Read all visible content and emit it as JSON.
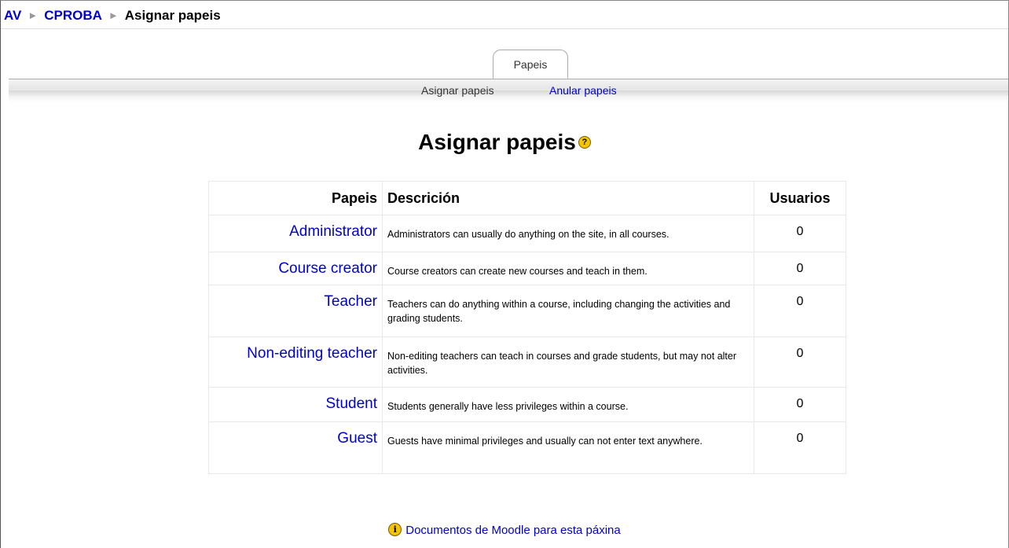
{
  "breadcrumb": {
    "items": [
      {
        "label": "AV"
      },
      {
        "label": "CPROBA"
      }
    ],
    "separator": "►",
    "current": "Asignar papeis"
  },
  "tabs": {
    "main": "Papeis",
    "sub": {
      "selected": "Asignar papeis",
      "other": "Anular papeis"
    }
  },
  "page": {
    "heading": "Asignar papeis",
    "help_icon_glyph": "?"
  },
  "table": {
    "headers": {
      "role": "Papeis",
      "description": "Descrición",
      "users": "Usuarios"
    },
    "rows": [
      {
        "role": "Administrator",
        "description": "Administrators can usually do anything on the site, in all courses.",
        "users": "0"
      },
      {
        "role": "Course creator",
        "description": "Course creators can create new courses and teach in them.",
        "users": "0"
      },
      {
        "role": "Teacher",
        "description": "Teachers can do anything within a course, including changing the activities and grading students.",
        "users": "0"
      },
      {
        "role": "Non-editing teacher",
        "description": "Non-editing teachers can teach in courses and grade students, but may not alter activities.",
        "users": "0"
      },
      {
        "role": "Student",
        "description": "Students generally have less privileges within a course.",
        "users": "0"
      },
      {
        "role": "Guest",
        "description": "Guests have minimal privileges and usually can not enter text anywhere.",
        "users": "0"
      }
    ]
  },
  "footer": {
    "docs_link": "Documentos de Moodle para esta páxina",
    "info_icon_glyph": "i"
  },
  "colors": {
    "link": "#0000cc",
    "icon_yellow": "#f5c400"
  }
}
